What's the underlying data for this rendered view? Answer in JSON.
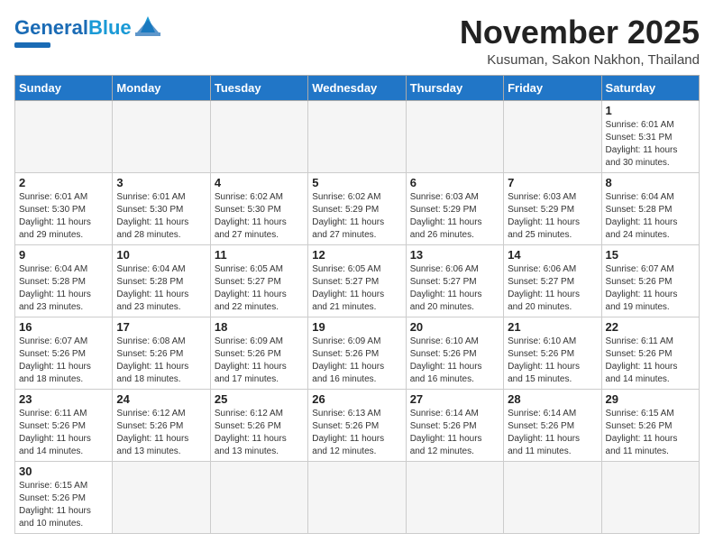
{
  "header": {
    "logo_general": "General",
    "logo_blue": "Blue",
    "month": "November 2025",
    "location": "Kusuman, Sakon Nakhon, Thailand"
  },
  "weekdays": [
    "Sunday",
    "Monday",
    "Tuesday",
    "Wednesday",
    "Thursday",
    "Friday",
    "Saturday"
  ],
  "weeks": [
    [
      {
        "day": "",
        "info": ""
      },
      {
        "day": "",
        "info": ""
      },
      {
        "day": "",
        "info": ""
      },
      {
        "day": "",
        "info": ""
      },
      {
        "day": "",
        "info": ""
      },
      {
        "day": "",
        "info": ""
      },
      {
        "day": "1",
        "info": "Sunrise: 6:01 AM\nSunset: 5:31 PM\nDaylight: 11 hours\nand 30 minutes."
      }
    ],
    [
      {
        "day": "2",
        "info": "Sunrise: 6:01 AM\nSunset: 5:30 PM\nDaylight: 11 hours\nand 29 minutes."
      },
      {
        "day": "3",
        "info": "Sunrise: 6:01 AM\nSunset: 5:30 PM\nDaylight: 11 hours\nand 28 minutes."
      },
      {
        "day": "4",
        "info": "Sunrise: 6:02 AM\nSunset: 5:30 PM\nDaylight: 11 hours\nand 27 minutes."
      },
      {
        "day": "5",
        "info": "Sunrise: 6:02 AM\nSunset: 5:29 PM\nDaylight: 11 hours\nand 27 minutes."
      },
      {
        "day": "6",
        "info": "Sunrise: 6:03 AM\nSunset: 5:29 PM\nDaylight: 11 hours\nand 26 minutes."
      },
      {
        "day": "7",
        "info": "Sunrise: 6:03 AM\nSunset: 5:29 PM\nDaylight: 11 hours\nand 25 minutes."
      },
      {
        "day": "8",
        "info": "Sunrise: 6:04 AM\nSunset: 5:28 PM\nDaylight: 11 hours\nand 24 minutes."
      }
    ],
    [
      {
        "day": "9",
        "info": "Sunrise: 6:04 AM\nSunset: 5:28 PM\nDaylight: 11 hours\nand 23 minutes."
      },
      {
        "day": "10",
        "info": "Sunrise: 6:04 AM\nSunset: 5:28 PM\nDaylight: 11 hours\nand 23 minutes."
      },
      {
        "day": "11",
        "info": "Sunrise: 6:05 AM\nSunset: 5:27 PM\nDaylight: 11 hours\nand 22 minutes."
      },
      {
        "day": "12",
        "info": "Sunrise: 6:05 AM\nSunset: 5:27 PM\nDaylight: 11 hours\nand 21 minutes."
      },
      {
        "day": "13",
        "info": "Sunrise: 6:06 AM\nSunset: 5:27 PM\nDaylight: 11 hours\nand 20 minutes."
      },
      {
        "day": "14",
        "info": "Sunrise: 6:06 AM\nSunset: 5:27 PM\nDaylight: 11 hours\nand 20 minutes."
      },
      {
        "day": "15",
        "info": "Sunrise: 6:07 AM\nSunset: 5:26 PM\nDaylight: 11 hours\nand 19 minutes."
      }
    ],
    [
      {
        "day": "16",
        "info": "Sunrise: 6:07 AM\nSunset: 5:26 PM\nDaylight: 11 hours\nand 18 minutes."
      },
      {
        "day": "17",
        "info": "Sunrise: 6:08 AM\nSunset: 5:26 PM\nDaylight: 11 hours\nand 18 minutes."
      },
      {
        "day": "18",
        "info": "Sunrise: 6:09 AM\nSunset: 5:26 PM\nDaylight: 11 hours\nand 17 minutes."
      },
      {
        "day": "19",
        "info": "Sunrise: 6:09 AM\nSunset: 5:26 PM\nDaylight: 11 hours\nand 16 minutes."
      },
      {
        "day": "20",
        "info": "Sunrise: 6:10 AM\nSunset: 5:26 PM\nDaylight: 11 hours\nand 16 minutes."
      },
      {
        "day": "21",
        "info": "Sunrise: 6:10 AM\nSunset: 5:26 PM\nDaylight: 11 hours\nand 15 minutes."
      },
      {
        "day": "22",
        "info": "Sunrise: 6:11 AM\nSunset: 5:26 PM\nDaylight: 11 hours\nand 14 minutes."
      }
    ],
    [
      {
        "day": "23",
        "info": "Sunrise: 6:11 AM\nSunset: 5:26 PM\nDaylight: 11 hours\nand 14 minutes."
      },
      {
        "day": "24",
        "info": "Sunrise: 6:12 AM\nSunset: 5:26 PM\nDaylight: 11 hours\nand 13 minutes."
      },
      {
        "day": "25",
        "info": "Sunrise: 6:12 AM\nSunset: 5:26 PM\nDaylight: 11 hours\nand 13 minutes."
      },
      {
        "day": "26",
        "info": "Sunrise: 6:13 AM\nSunset: 5:26 PM\nDaylight: 11 hours\nand 12 minutes."
      },
      {
        "day": "27",
        "info": "Sunrise: 6:14 AM\nSunset: 5:26 PM\nDaylight: 11 hours\nand 12 minutes."
      },
      {
        "day": "28",
        "info": "Sunrise: 6:14 AM\nSunset: 5:26 PM\nDaylight: 11 hours\nand 11 minutes."
      },
      {
        "day": "29",
        "info": "Sunrise: 6:15 AM\nSunset: 5:26 PM\nDaylight: 11 hours\nand 11 minutes."
      }
    ],
    [
      {
        "day": "30",
        "info": "Sunrise: 6:15 AM\nSunset: 5:26 PM\nDaylight: 11 hours\nand 10 minutes."
      },
      {
        "day": "",
        "info": ""
      },
      {
        "day": "",
        "info": ""
      },
      {
        "day": "",
        "info": ""
      },
      {
        "day": "",
        "info": ""
      },
      {
        "day": "",
        "info": ""
      },
      {
        "day": "",
        "info": ""
      }
    ]
  ]
}
